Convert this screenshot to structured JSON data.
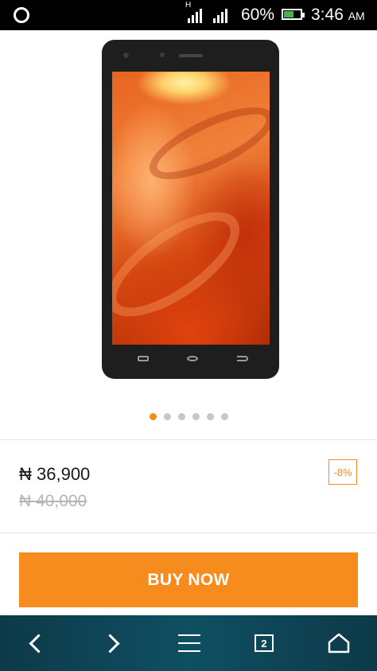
{
  "status_bar": {
    "network_type": "H",
    "battery_percent": "60%",
    "battery_level": 0.6,
    "time": "3:46",
    "ampm": "AM",
    "battery_color": "#4caf50"
  },
  "carousel": {
    "image": "product-phone-image",
    "slides_count": 6,
    "active_index": 0,
    "active_color": "#f68b1e"
  },
  "product": {
    "price": "₦ 36,900",
    "old_price": "₦ 40,000",
    "discount": "-8%"
  },
  "actions": {
    "buy_label": "BUY NOW",
    "buy_color": "#f68b1e"
  },
  "browser_bar": {
    "tab_count": "2",
    "icons": [
      "back-icon",
      "forward-icon",
      "menu-icon",
      "tabs-icon",
      "home-icon"
    ]
  }
}
